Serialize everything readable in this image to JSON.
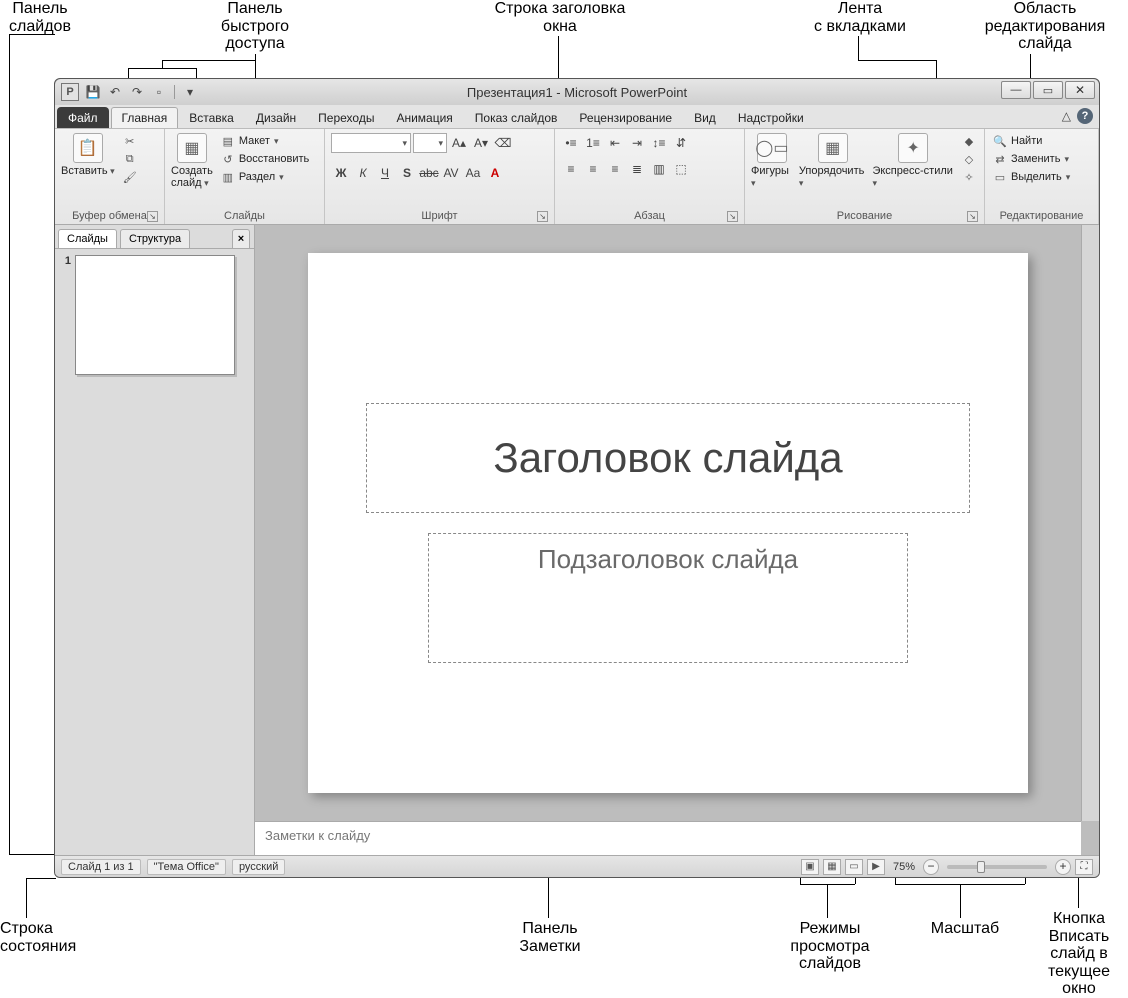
{
  "callouts": {
    "slides_panel": "Панель\nслайдов",
    "quick_access": "Панель\nбыстрого\nдоступа",
    "title_bar": "Строка заголовка\nокна",
    "ribbon": "Лента\nс вкладками",
    "edit_area": "Область\nредактирования\nслайда",
    "status_bar": "Строка\nсостояния",
    "notes_panel": "Панель\nЗаметки",
    "view_modes": "Режимы\nпросмотра\nслайдов",
    "zoom": "Масштаб",
    "fit_button": "Кнопка\nВписать\nслайд в\nтекущее окно"
  },
  "title": "Презентация1 - Microsoft PowerPoint",
  "tabs": {
    "file": "Файл",
    "home": "Главная",
    "insert": "Вставка",
    "design": "Дизайн",
    "transitions": "Переходы",
    "animation": "Анимация",
    "slideshow": "Показ слайдов",
    "review": "Рецензирование",
    "view": "Вид",
    "addins": "Надстройки"
  },
  "groups": {
    "clipboard": {
      "label": "Буфер обмена",
      "paste": "Вставить"
    },
    "slides": {
      "label": "Слайды",
      "new": "Создать\nслайд",
      "layout": "Макет",
      "reset": "Восстановить",
      "section": "Раздел"
    },
    "font": {
      "label": "Шрифт"
    },
    "paragraph": {
      "label": "Абзац"
    },
    "drawing": {
      "label": "Рисование",
      "shapes": "Фигуры",
      "arrange": "Упорядочить",
      "styles": "Экспресс-стили"
    },
    "editing": {
      "label": "Редактирование",
      "find": "Найти",
      "replace": "Заменить",
      "select": "Выделить"
    }
  },
  "font_icons": {
    "bold": "Ж",
    "italic": "К",
    "underline": "Ч",
    "strike": "S",
    "abc": "abc",
    "av": "AV",
    "aa": "Aa",
    "bigA": "A",
    "growA": "A▴",
    "shrinkA": "A▾"
  },
  "left_tabs": {
    "slides": "Слайды",
    "outline": "Структура"
  },
  "thumb_number": "1",
  "slide": {
    "title": "Заголовок слайда",
    "subtitle": "Подзаголовок слайда"
  },
  "notes_placeholder": "Заметки к слайду",
  "status": {
    "slide_of": "Слайд 1 из 1",
    "theme": "\"Тема Office\"",
    "lang": "русский",
    "zoom": "75%"
  }
}
